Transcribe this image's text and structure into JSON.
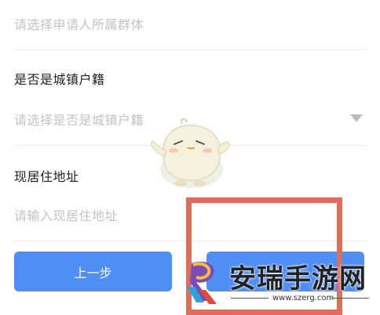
{
  "form": {
    "group_placeholder": "请选择申请人所属群体",
    "urban_label": "是否是城镇户籍",
    "urban_placeholder": "请选择是否是城镇户籍",
    "address_label": "现居住地址",
    "address_placeholder": "请输入现居住地址"
  },
  "buttons": {
    "prev_label": "上一步",
    "next_label": ""
  },
  "watermark": {
    "site_name": "安瑞手游网",
    "site_url": "www.szerg.com"
  },
  "colors": {
    "button_blue": "#4f8ef5",
    "highlight_red": "#e56a5c",
    "placeholder_gray": "#c3c3c3"
  },
  "icons": [
    "dropdown-triangle-icon",
    "mascot-chick-icon",
    "site-logo-icon"
  ]
}
